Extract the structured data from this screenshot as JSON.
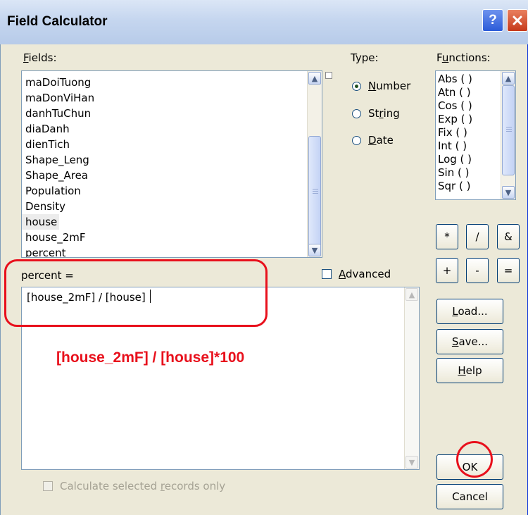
{
  "window": {
    "title": "Field Calculator"
  },
  "fields": {
    "label": "Fields:",
    "items": [
      "maDoiTuong",
      "maDonViHan",
      "danhTuChun",
      "diaDanh",
      "dienTich",
      "Shape_Leng",
      "Shape_Area",
      "Population",
      "Density",
      "house",
      "house_2mF",
      "percent"
    ],
    "selected": "house"
  },
  "type": {
    "label": "Type:",
    "options": [
      "Number",
      "String",
      "Date"
    ],
    "selected": "Number"
  },
  "functions": {
    "label": "Functions:",
    "items": [
      "Abs ( )",
      "Atn ( )",
      "Cos ( )",
      "Exp ( )",
      "Fix ( )",
      "Int ( )",
      "Log ( )",
      "Sin ( )",
      "Sqr ( )"
    ]
  },
  "operators": [
    "*",
    "/",
    "&",
    "+",
    "-",
    "="
  ],
  "expression": {
    "label": "percent =",
    "value": "[house_2mF] / [house]"
  },
  "advanced": {
    "label": "Advanced",
    "checked": false
  },
  "buttons": {
    "load": "Load...",
    "save": "Save...",
    "help": "Help",
    "ok": "OK",
    "cancel": "Cancel"
  },
  "calc_selected": {
    "label": "Calculate selected records only",
    "enabled": false
  },
  "annotation": {
    "note": "[house_2mF] / [house]*100",
    "color": "#e8101c"
  }
}
